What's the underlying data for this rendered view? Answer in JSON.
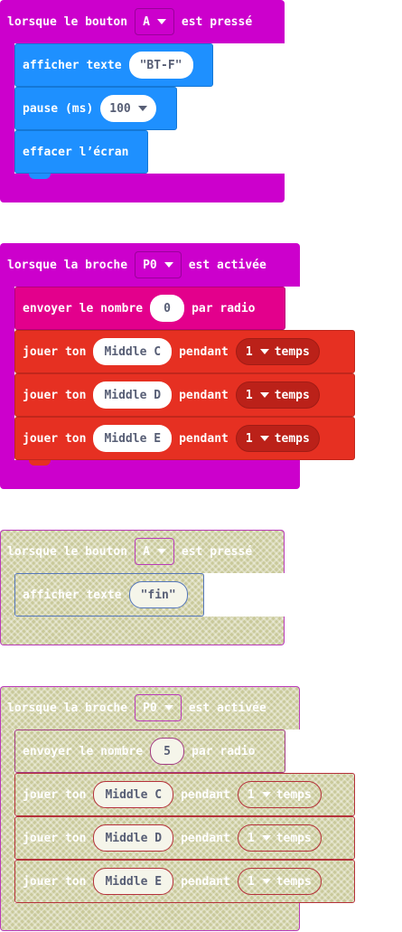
{
  "colors": {
    "event_magenta": "#cc00cc",
    "basic_blue": "#1e90ff",
    "radio_pink": "#e3008c",
    "music_red": "#e63022",
    "music_dark": "#bb2119",
    "disabled_fill": "#c9c99a"
  },
  "block1": {
    "text1": "lorsque le bouton",
    "button": "A",
    "text2": "est pressé",
    "show_label": "afficher texte",
    "show_value": "BT-F",
    "pause_label": "pause (ms)",
    "pause_value": "100",
    "clear_label": "effacer l’écran"
  },
  "block2": {
    "text1": "lorsque la broche",
    "pin": "P0",
    "text2": "est activée",
    "send_label": "envoyer le nombre",
    "send_value": "0",
    "send_suffix": "par radio",
    "tones": [
      {
        "label": "jouer ton",
        "note": "Middle C",
        "during": "pendant",
        "beats": "1",
        "unit": "temps"
      },
      {
        "label": "jouer ton",
        "note": "Middle D",
        "during": "pendant",
        "beats": "1",
        "unit": "temps"
      },
      {
        "label": "jouer ton",
        "note": "Middle E",
        "during": "pendant",
        "beats": "1",
        "unit": "temps"
      }
    ]
  },
  "block3": {
    "text1": "lorsque le bouton",
    "button": "A",
    "text2": "est pressé",
    "show_label": "afficher texte",
    "show_value": "fin"
  },
  "block4": {
    "text1": "lorsque la broche",
    "pin": "P0",
    "text2": "est activée",
    "send_label": "envoyer le nombre",
    "send_value": "5",
    "send_suffix": "par radio",
    "tones": [
      {
        "label": "jouer ton",
        "note": "Middle C",
        "during": "pendant",
        "beats": "1",
        "unit": "temps"
      },
      {
        "label": "jouer ton",
        "note": "Middle D",
        "during": "pendant",
        "beats": "1",
        "unit": "temps"
      },
      {
        "label": "jouer ton",
        "note": "Middle E",
        "during": "pendant",
        "beats": "1",
        "unit": "temps"
      }
    ]
  }
}
